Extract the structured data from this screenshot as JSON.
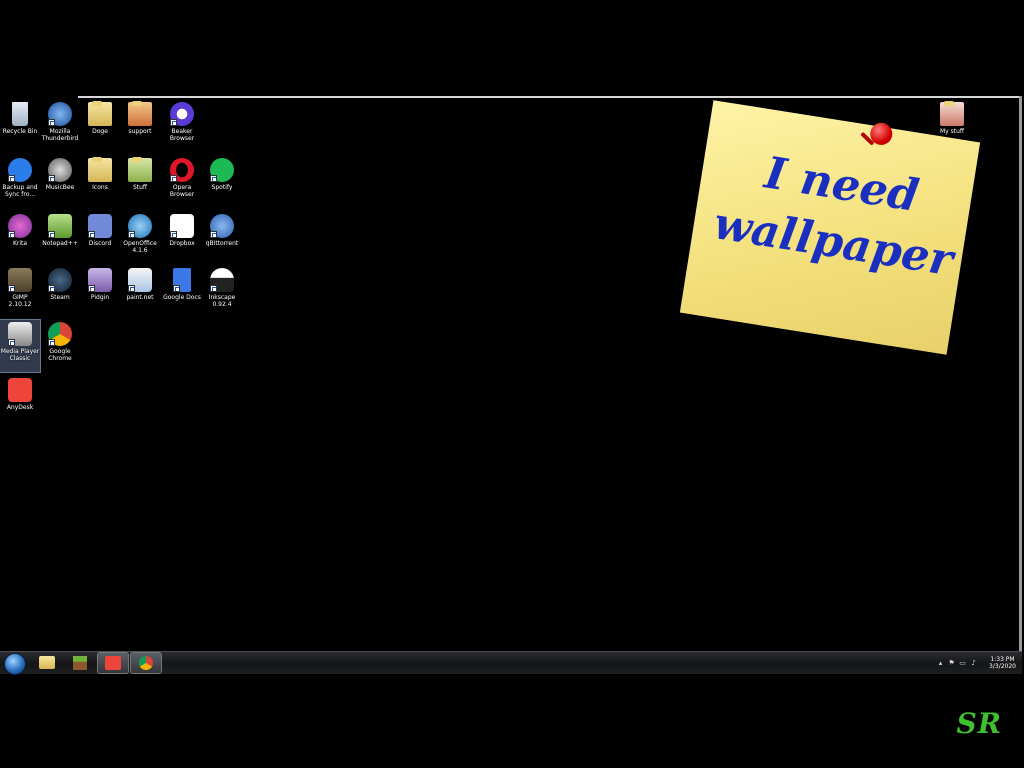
{
  "desktop": {
    "icons": [
      {
        "label": "Recycle Bin",
        "icon": "recycle-bin-icon"
      },
      {
        "label": "Mozilla Thunderbird",
        "icon": "thunderbird-icon"
      },
      {
        "label": "Doge",
        "icon": "folder-icon"
      },
      {
        "label": "support",
        "icon": "folder-icon"
      },
      {
        "label": "Beaker Browser",
        "icon": "beaker-browser-icon"
      },
      {
        "label": "Backup and Sync fro...",
        "icon": "google-backup-icon"
      },
      {
        "label": "MusicBee",
        "icon": "musicbee-icon"
      },
      {
        "label": "Icons",
        "icon": "folder-icon"
      },
      {
        "label": "Stuff",
        "icon": "folder-icon"
      },
      {
        "label": "Opera Browser",
        "icon": "opera-icon"
      },
      {
        "label": "Spotify",
        "icon": "spotify-icon"
      },
      {
        "label": "Krita",
        "icon": "krita-icon"
      },
      {
        "label": "Notepad++",
        "icon": "notepad-plus-plus-icon"
      },
      {
        "label": "Discord",
        "icon": "discord-icon"
      },
      {
        "label": "OpenOffice 4.1.6",
        "icon": "openoffice-icon"
      },
      {
        "label": "Dropbox",
        "icon": "dropbox-icon"
      },
      {
        "label": "qBittorrent",
        "icon": "qbittorrent-icon"
      },
      {
        "label": "GIMP 2.10.12",
        "icon": "gimp-icon"
      },
      {
        "label": "Steam",
        "icon": "steam-icon"
      },
      {
        "label": "Pidgin",
        "icon": "pidgin-icon"
      },
      {
        "label": "paint.net",
        "icon": "paint-net-icon"
      },
      {
        "label": "Google Docs",
        "icon": "google-docs-icon"
      },
      {
        "label": "Inkscape 0.92.4",
        "icon": "inkscape-icon"
      },
      {
        "label": "Media Player Classic",
        "icon": "media-player-classic-icon"
      },
      {
        "label": "Google Chrome",
        "icon": "chrome-icon"
      },
      {
        "label": "AnyDesk",
        "icon": "anydesk-icon"
      },
      {
        "label": "My stuff",
        "icon": "folder-icon"
      }
    ],
    "wallpaper_note": {
      "text": "I need wallpaper",
      "color": "#1a2fc0",
      "note_color": "#f6e68c"
    }
  },
  "taskbar": {
    "pinned": [
      {
        "icon": "start-orb-icon"
      },
      {
        "icon": "file-explorer-icon"
      },
      {
        "icon": "minecraft-icon"
      },
      {
        "icon": "anydesk-icon"
      },
      {
        "icon": "chrome-icon"
      }
    ],
    "tray": {
      "time": "1:33 PM",
      "date": "3/3/2020"
    }
  },
  "watermark": {
    "text": "SR",
    "color": "#3fbf2f"
  }
}
